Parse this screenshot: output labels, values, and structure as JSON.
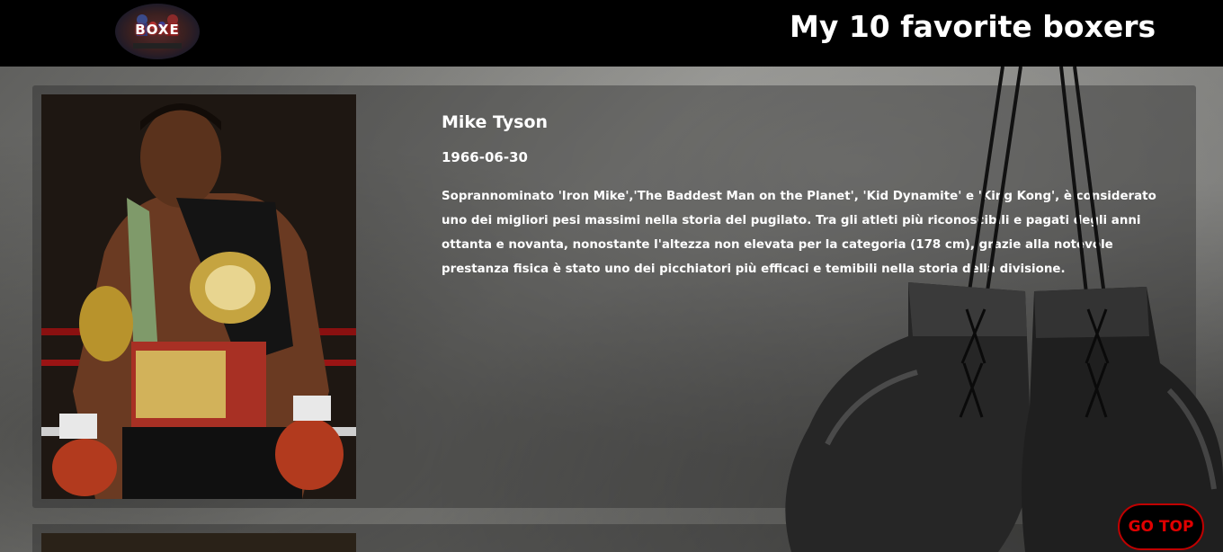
{
  "header": {
    "logo_text": "BOXE",
    "title": "My 10 favorite boxers"
  },
  "boxers": [
    {
      "name": "Mike Tyson",
      "birth_date": "1966-06-30",
      "description": "Soprannominato 'Iron Mike','The Baddest Man on the Planet', 'Kid Dynamite' e 'King Kong', è considerato uno dei migliori pesi massimi nella storia del pugilato. Tra gli atleti più riconoscibili e pagati degli anni ottanta e novanta, nonostante l'altezza non elevata per la categoria (178 cm), grazie alla notevole prestanza fisica è stato uno dei picchiatori più efficaci e temibili nella storia della divisione."
    }
  ],
  "go_top_label": "GO TOP",
  "colors": {
    "header_bg": "#000000",
    "title_text": "#ffffff",
    "go_top_text": "#e00000",
    "go_top_border": "#c00000"
  }
}
